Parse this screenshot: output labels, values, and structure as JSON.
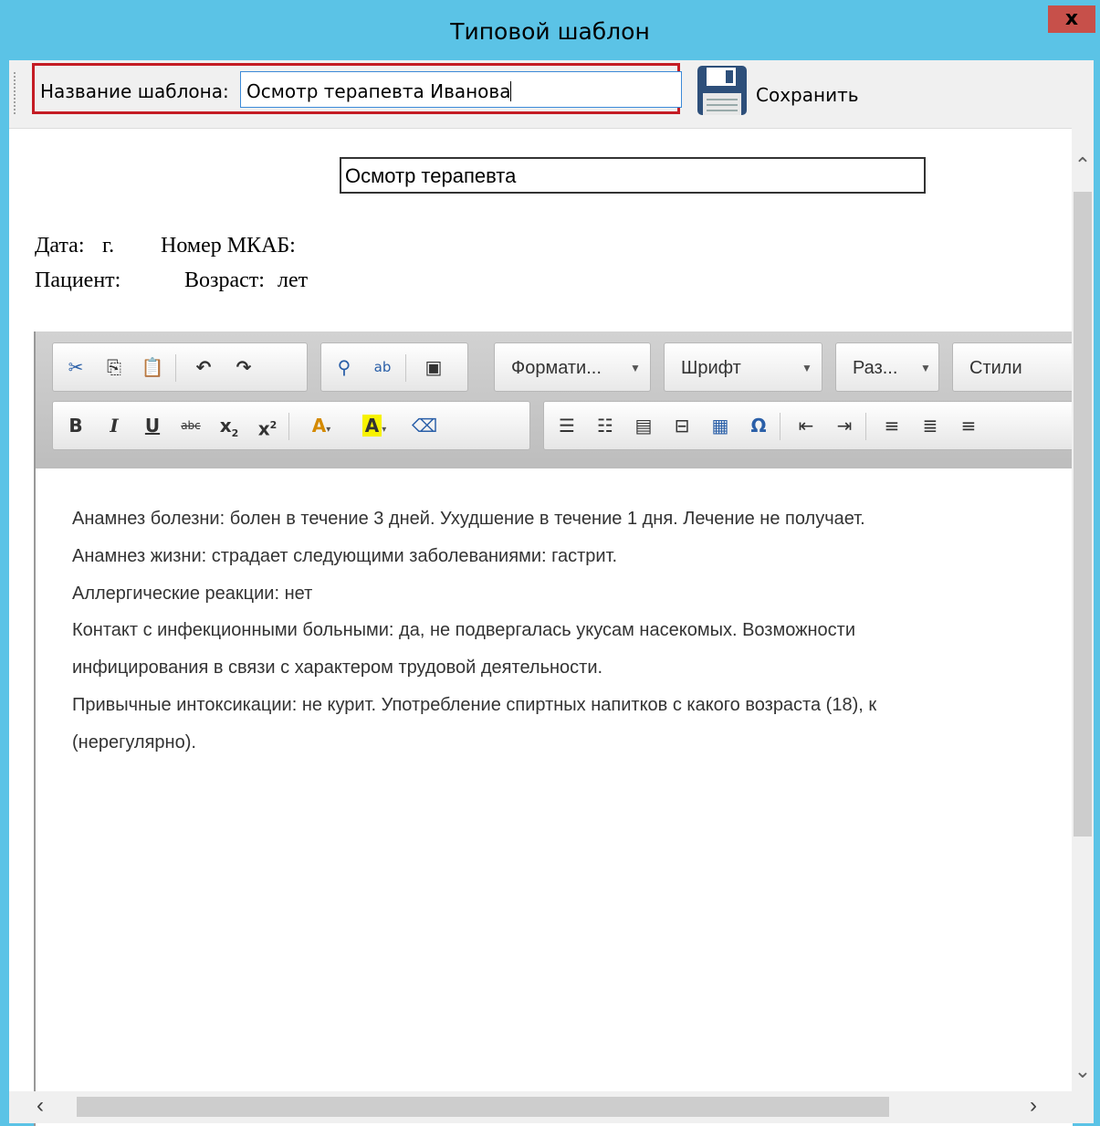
{
  "window": {
    "title": "Типовой шаблон",
    "close_label": "x"
  },
  "toolbar": {
    "name_label": "Название шаблона:",
    "name_value": "Осмотр терапевта Иванова",
    "save_label": "Сохранить"
  },
  "document": {
    "title": "Осмотр терапевта",
    "date_label": "Дата:",
    "date_suffix": "г.",
    "mkab_label": "Номер МКАБ:",
    "patient_label": "Пациент:",
    "age_label": "Возраст:",
    "age_suffix": "лет"
  },
  "editor": {
    "combos": {
      "format": "Формати...",
      "font": "Шрифт",
      "size": "Раз...",
      "styles": "Стили"
    },
    "paragraphs": [
      "Анамнез болезни: болен в течение 3 дней. Ухудшение в течение 1 дня. Лечение не получает.",
      "Анамнез жизни: страдает следующими заболеваниями: гастрит.",
      "Аллергические реакции: нет",
      "Контакт с инфекционными больными: да, не подвергалась укусам насекомых. Возможности",
      "инфицирования в связи с характером трудовой деятельности.",
      "Привычные интоксикации: не курит. Употребление спиртных напитков с какого возраста (18), к",
      "(нерегулярно)."
    ]
  }
}
